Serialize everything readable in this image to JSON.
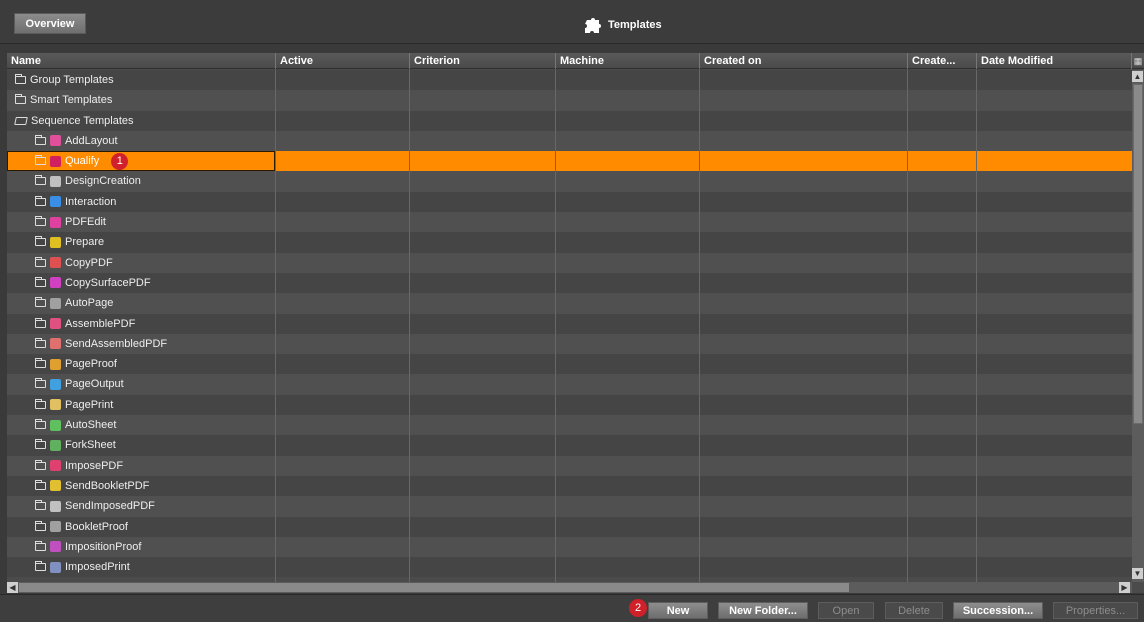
{
  "header": {
    "overview_label": "Overview",
    "title": "Templates"
  },
  "table": {
    "columns": [
      "Name",
      "Active",
      "Criterion",
      "Machine",
      "Created on",
      "Create...",
      "Date Modified"
    ],
    "rows": [
      {
        "label": "Group Templates",
        "level": 0,
        "icon": "folder-icon"
      },
      {
        "label": "Smart Templates",
        "level": 0,
        "icon": "folder-icon"
      },
      {
        "label": "Sequence Templates",
        "level": 0,
        "icon": "open-folder-icon"
      },
      {
        "label": "AddLayout",
        "level": 1,
        "icon": "addlayout-icon",
        "color": "#e0509a"
      },
      {
        "label": "Qualify",
        "level": 1,
        "icon": "qualify-icon",
        "color": "#d02060",
        "selected": true,
        "badge": "1"
      },
      {
        "label": "DesignCreation",
        "level": 1,
        "icon": "designcreation-icon",
        "color": "#c0c0c0"
      },
      {
        "label": "Interaction",
        "level": 1,
        "icon": "interaction-icon",
        "color": "#3a8ee6"
      },
      {
        "label": "PDFEdit",
        "level": 1,
        "icon": "pdfedit-icon",
        "color": "#e040a0"
      },
      {
        "label": "Prepare",
        "level": 1,
        "icon": "prepare-icon",
        "color": "#e0c020"
      },
      {
        "label": "CopyPDF",
        "level": 1,
        "icon": "copypdf-icon",
        "color": "#e05050"
      },
      {
        "label": "CopySurfacePDF",
        "level": 1,
        "icon": "copysurfacepdf-icon",
        "color": "#d040c0"
      },
      {
        "label": "AutoPage",
        "level": 1,
        "icon": "autopage-icon",
        "color": "#a0a0a0"
      },
      {
        "label": "AssemblePDF",
        "level": 1,
        "icon": "assemblepdf-icon",
        "color": "#e05080"
      },
      {
        "label": "SendAssembledPDF",
        "level": 1,
        "icon": "sendassembledpdf-icon",
        "color": "#e07070"
      },
      {
        "label": "PageProof",
        "level": 1,
        "icon": "pageproof-icon",
        "color": "#e0a030"
      },
      {
        "label": "PageOutput",
        "level": 1,
        "icon": "pageoutput-icon",
        "color": "#40a0e0"
      },
      {
        "label": "PagePrint",
        "level": 1,
        "icon": "pageprint-icon",
        "color": "#e0c060"
      },
      {
        "label": "AutoSheet",
        "level": 1,
        "icon": "autosheet-icon",
        "color": "#60c060"
      },
      {
        "label": "ForkSheet",
        "level": 1,
        "icon": "forksheet-icon",
        "color": "#60b060"
      },
      {
        "label": "ImposePDF",
        "level": 1,
        "icon": "imposepdf-icon",
        "color": "#e04070"
      },
      {
        "label": "SendBookletPDF",
        "level": 1,
        "icon": "sendbookletpdf-icon",
        "color": "#e0c030"
      },
      {
        "label": "SendImposedPDF",
        "level": 1,
        "icon": "sendimposedpdf-icon",
        "color": "#c0c0c0"
      },
      {
        "label": "BookletProof",
        "level": 1,
        "icon": "bookletproof-icon",
        "color": "#a0a0a0"
      },
      {
        "label": "ImpositionProof",
        "level": 1,
        "icon": "impositionproof-icon",
        "color": "#c050c0"
      },
      {
        "label": "ImposedPrint",
        "level": 1,
        "icon": "imposedprint-icon",
        "color": "#8090c0"
      }
    ]
  },
  "footer": {
    "badge": "2",
    "new_label": "New",
    "new_folder_label": "New Folder...",
    "open_label": "Open",
    "delete_label": "Delete",
    "succession_label": "Succession...",
    "properties_label": "Properties..."
  },
  "colors": {
    "selection": "#ff8c00",
    "badge": "#d0202a"
  }
}
